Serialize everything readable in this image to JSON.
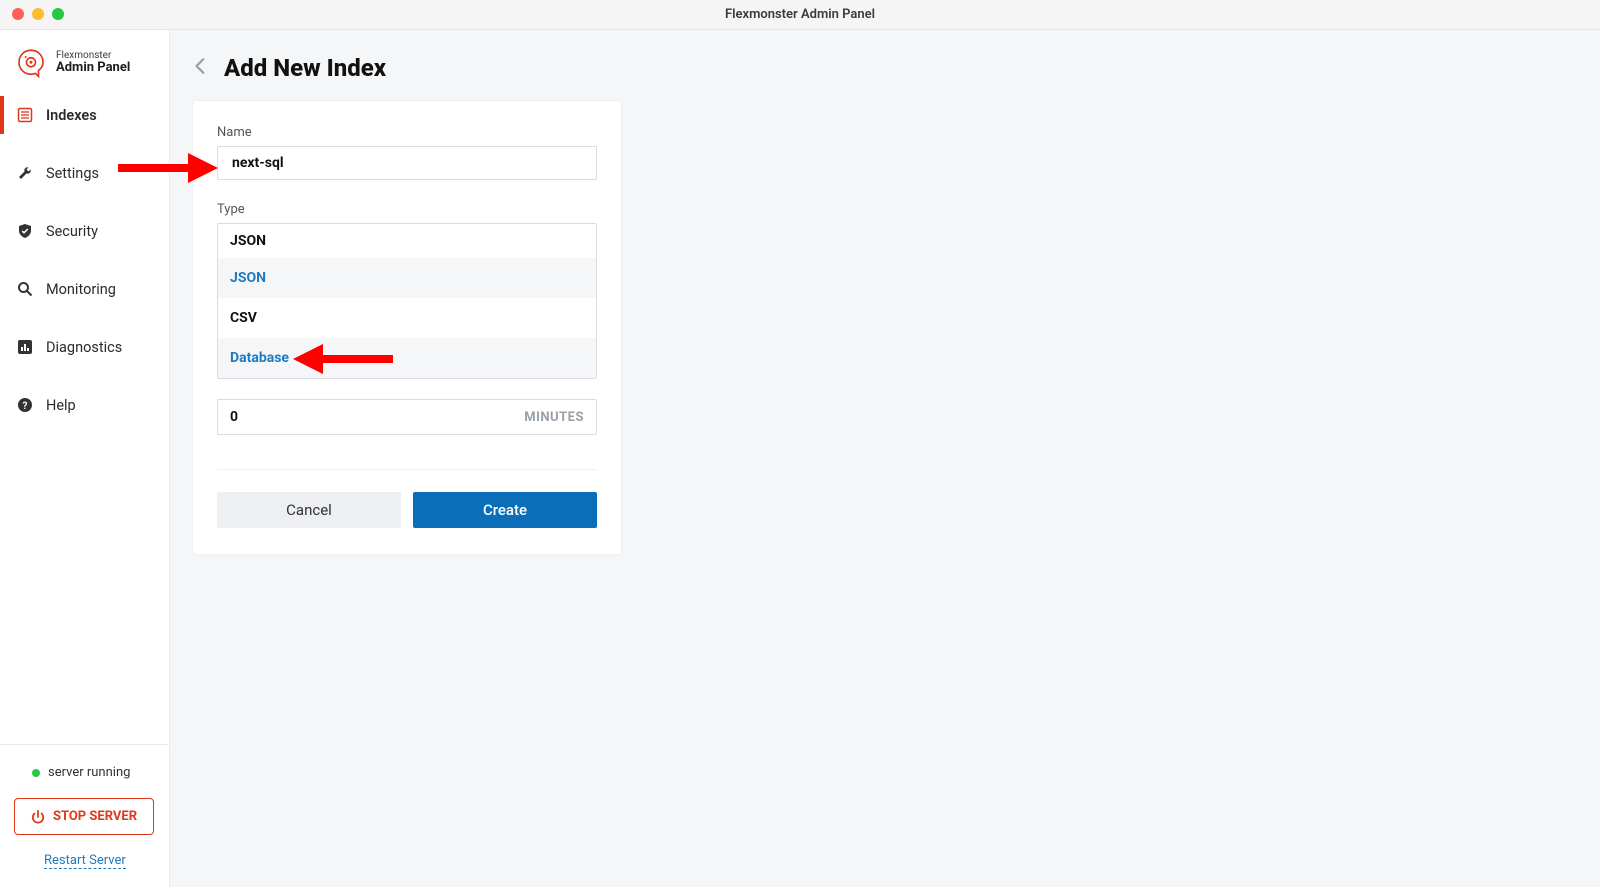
{
  "window": {
    "title": "Flexmonster Admin Panel"
  },
  "brand": {
    "small": "Flexmonster",
    "big": "Admin Panel"
  },
  "sidebar": {
    "items": [
      {
        "label": "Indexes"
      },
      {
        "label": "Settings"
      },
      {
        "label": "Security"
      },
      {
        "label": "Monitoring"
      },
      {
        "label": "Diagnostics"
      },
      {
        "label": "Help"
      }
    ],
    "status": "server running",
    "stop_btn": "STOP SERVER",
    "restart": "Restart Server"
  },
  "page": {
    "title": "Add New Index",
    "name_label": "Name",
    "name_value": "next-sql",
    "type_label": "Type",
    "type_selected": "JSON",
    "type_options": [
      {
        "label": "JSON",
        "selected": true,
        "alt": true
      },
      {
        "label": "CSV",
        "selected": false,
        "alt": false
      },
      {
        "label": "Database",
        "selected": true,
        "alt": true
      }
    ],
    "minutes_value": "0",
    "minutes_unit": "MINUTES",
    "cancel_label": "Cancel",
    "create_label": "Create"
  }
}
